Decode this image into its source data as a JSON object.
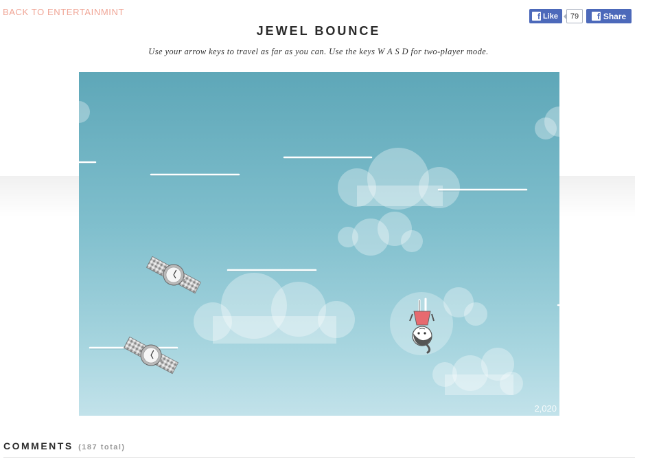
{
  "nav": {
    "back_label": "BACK TO ENTERTAINMINT"
  },
  "social": {
    "like_label": "Like",
    "like_count": "79",
    "share_label": "Share",
    "fb_icon": "facebook-icon",
    "color": "#4c69ba"
  },
  "header": {
    "title": "JEWEL BOUNCE",
    "instructions": "Use your arrow keys to travel as far as you can. Use the keys W A S D for two-player mode."
  },
  "game": {
    "score": "2,020",
    "sky_color": "#80bfcd",
    "sprites": [
      "platform",
      "wristwatch-jewel",
      "player-character",
      "cloud"
    ]
  },
  "comments": {
    "title": "COMMENTS",
    "count_label": "(187 total)"
  }
}
